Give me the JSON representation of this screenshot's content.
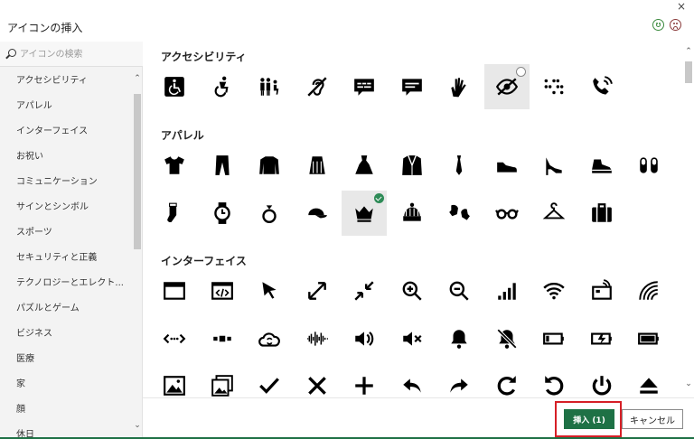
{
  "window": {
    "title": "アイコンの挿入",
    "close_label": "×"
  },
  "search": {
    "placeholder": "アイコンの検索"
  },
  "categories": [
    "アクセシビリティ",
    "アパレル",
    "インターフェイス",
    "お祝い",
    "コミュニケーション",
    "サインとシンボル",
    "スポーツ",
    "セキュリティと正義",
    "テクノロジーとエレクト...",
    "パズルとゲーム",
    "ビジネス",
    "医療",
    "家",
    "顔",
    "休日"
  ],
  "sections": [
    {
      "title": "アクセシビリティ",
      "icons": [
        "wheelchair-sign-icon",
        "wheelchair-active-icon",
        "family-icon",
        "hearing-impaired-icon",
        "closed-caption-icon",
        "audio-description-icon",
        "sign-language-icon",
        "low-vision-icon",
        "braille-icon",
        "volume-control-phone-icon"
      ]
    },
    {
      "title": "アパレル",
      "icons": [
        "tshirt-icon",
        "pants-icon",
        "sweater-icon",
        "skirt-icon",
        "dress-icon",
        "suit-jacket-icon",
        "tie-icon",
        "shoe-icon",
        "high-heel-icon",
        "sneaker-icon",
        "slippers-icon",
        "sock-icon",
        "watch-icon",
        "ring-icon",
        "cap-icon",
        "crown-icon",
        "beanie-icon",
        "mittens-icon",
        "glasses-icon",
        "hanger-icon",
        "suitcase-icon"
      ]
    },
    {
      "title": "インターフェイス",
      "icons": [
        "browser-window-icon",
        "code-window-icon",
        "cursor-icon",
        "expand-icon",
        "collapse-icon",
        "zoom-in-icon",
        "zoom-out-icon",
        "signal-bars-icon",
        "wifi-icon",
        "contactless-card-icon",
        "signal-arc-icon",
        "dots-arrows-icon",
        "connector-icon",
        "cloud-sync-icon",
        "soundwave-icon",
        "speaker-icon",
        "mute-icon",
        "bell-icon",
        "bell-off-icon",
        "battery-low-icon",
        "battery-charging-icon",
        "battery-full-icon",
        "pictures-icon",
        "photo-gallery-icon",
        "checkmark-icon",
        "close-icon",
        "plus-icon",
        "reply-icon",
        "forward-icon",
        "rotate-right-icon",
        "rotate-left-icon",
        "power-icon",
        "eject-icon"
      ]
    }
  ],
  "selected_count": 1,
  "buttons": {
    "insert_label": "挿入 (1)",
    "cancel_label": "キャンセル"
  },
  "colors": {
    "accent": "#1e7145",
    "highlight": "#d61f26",
    "check": "#2e8b57"
  }
}
